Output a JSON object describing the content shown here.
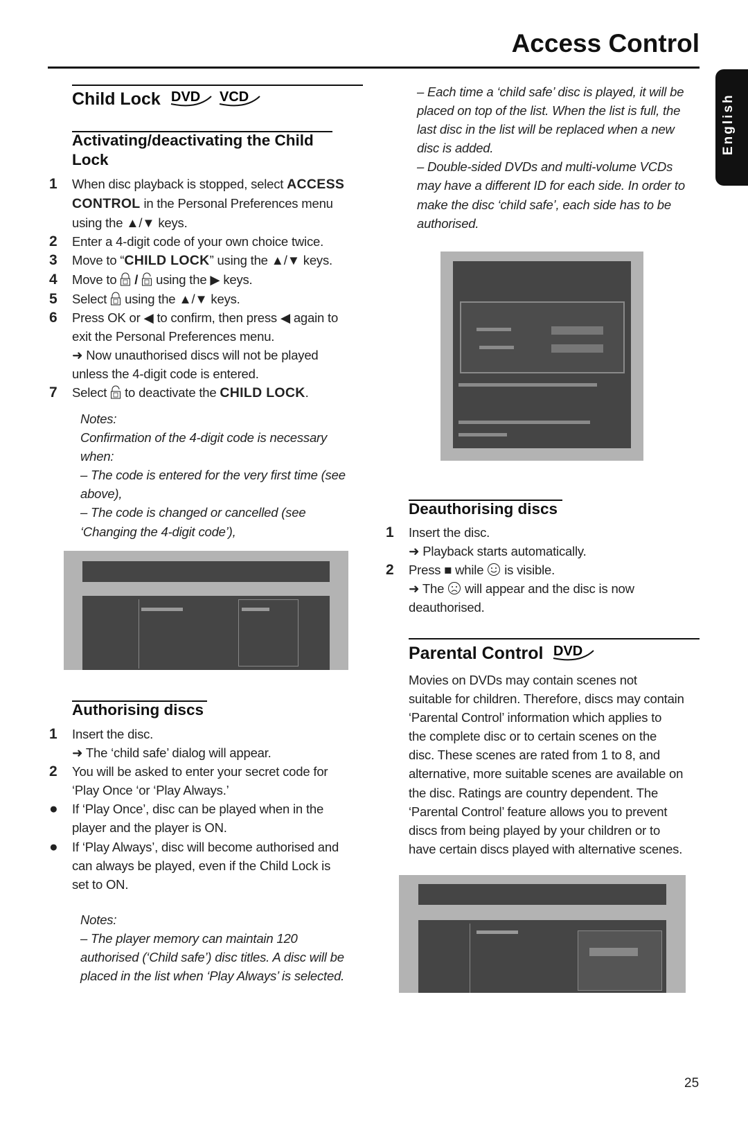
{
  "header": {
    "title": "Access Control"
  },
  "language_tab": "English",
  "child_lock": {
    "heading": "Child Lock",
    "logos": [
      "DVD",
      "VCD"
    ],
    "sub_heading_l1": "Activating/deactivating the Child",
    "sub_heading_l2": "Lock",
    "s1a": "When disc playback is stopped, select ",
    "s1b": "ACCESS",
    "s1c": "CONTROL",
    "s1d": " in the Personal Preferences menu",
    "s1e": "using the ▲/▼ keys.",
    "s2": "Enter a 4-digit code of your own choice twice.",
    "s3a": "Move to “",
    "s3b": "CHILD LOCK",
    "s3c": "” using the ▲/▼ keys.",
    "s4a": "Move to ",
    "s4b": " / ",
    "s4c": " using the ▶ keys.",
    "s5a": "Select ",
    "s5b": " using the ▲/▼ keys.",
    "s6a": "Press OK or ◀ to confirm, then press ◀ again to",
    "s6b": "exit the Personal Preferences menu.",
    "s6c": "➜ Now unauthorised discs will not be played",
    "s6d": "unless the 4-digit code is entered.",
    "s7a": "Select ",
    "s7b": " to deactivate the ",
    "s7c": "CHILD LOCK",
    "s7d": ".",
    "nums": [
      "1",
      "2",
      "3",
      "4",
      "5",
      "6",
      "7"
    ],
    "notes": [
      "Notes:",
      "Confirmation of the 4-digit code is necessary",
      "when:",
      "–   The code is entered for the very first time (see",
      "above),",
      "–   The code is changed or cancelled (see",
      "‘Changing the 4-digit code’),"
    ]
  },
  "authorising": {
    "heading": "Authorising discs",
    "lines": [
      "Insert the disc.",
      "➜ The ‘child safe’ dialog will appear.",
      "You will be asked to enter your secret code for",
      "‘Play Once ‘or ‘Play Always.’",
      "If ‘Play Once’, disc can be played when in the",
      "player and the player is ON.",
      "If ‘Play Always’, disc will become authorised and",
      "can always be played, even if the Child Lock is",
      "set to ON."
    ],
    "markers": [
      "1",
      "2",
      "●",
      "●"
    ],
    "notes": [
      "Notes:",
      "–   The player memory can maintain 120",
      "authorised (‘Child safe’) disc titles. A disc will be",
      "placed in the list when ‘Play Always’ is selected."
    ]
  },
  "right_notes": [
    "–   Each time a ‘child safe’ disc is played, it will be",
    "placed on top of the list. When the list is full, the",
    "last disc in the list will be replaced when a new",
    "disc is added.",
    "–   Double-sided DVDs and multi-volume VCDs",
    "may have a different ID for each side. In order to",
    "make the disc ‘child safe’, each side has to be",
    "authorised."
  ],
  "deauthorising": {
    "heading": "Deauthorising discs",
    "markers": [
      "1",
      "2"
    ],
    "l1": "Insert the disc.",
    "l2": "➜ Playback starts automatically.",
    "l3a": "Press ■ while ",
    "l3b": " is visible.",
    "l4a": "➜ The ",
    "l4b": " will appear and the disc is now",
    "l5": "deauthorised."
  },
  "parental": {
    "heading": "Parental Control",
    "logo": "DVD",
    "lines": [
      "Movies on DVDs may contain scenes not",
      "suitable for children. Therefore, discs may contain",
      "‘Parental Control’ information which applies to",
      "the complete disc or to certain scenes on the",
      "disc. These scenes are rated from 1 to 8, and",
      "alternative, more suitable scenes are available on",
      "the disc. Ratings are country dependent. The",
      "‘Parental Control’ feature allows you to prevent",
      "discs from being played by your children or to",
      "have certain discs played with alternative scenes."
    ]
  },
  "page_number": "25"
}
